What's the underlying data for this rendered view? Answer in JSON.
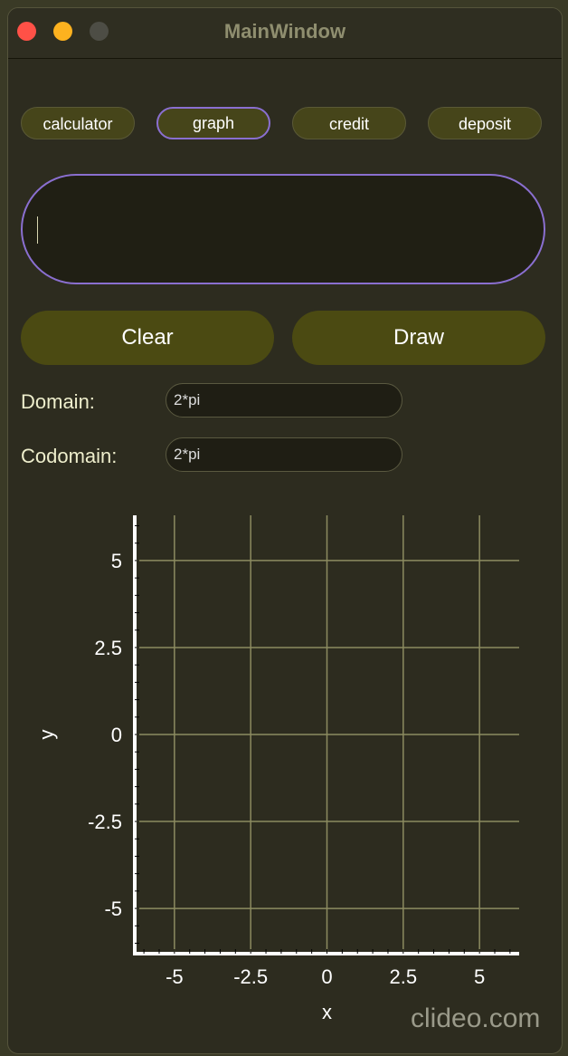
{
  "window": {
    "title": "MainWindow"
  },
  "tabs": [
    {
      "label": "calculator",
      "active": false
    },
    {
      "label": "graph",
      "active": true
    },
    {
      "label": "credit",
      "active": false
    },
    {
      "label": "deposit",
      "active": false
    }
  ],
  "expression": {
    "value": ""
  },
  "buttons": {
    "clear": "Clear",
    "draw": "Draw"
  },
  "domain": {
    "label": "Domain:",
    "value": "2*pi"
  },
  "codomain": {
    "label": "Codomain:",
    "value": "2*pi"
  },
  "chart_data": {
    "type": "line",
    "series": [],
    "xlabel": "x",
    "ylabel": "y",
    "xlim": [
      -6.3,
      6.3
    ],
    "ylim": [
      -6.3,
      6.3
    ],
    "xticks": [
      -5,
      -2.5,
      0,
      2.5,
      5
    ],
    "yticks": [
      -5,
      -2.5,
      0,
      2.5,
      5
    ],
    "xtick_labels": [
      "-5",
      "-2.5",
      "0",
      "2.5",
      "5"
    ],
    "ytick_labels": [
      "-5",
      "-2.5",
      "0",
      "2.5",
      "5"
    ],
    "grid": true
  },
  "watermark": "clideo.com",
  "colors": {
    "accent": "#8a6fd0",
    "button": "#4b4a12",
    "grid": "#8c8b60"
  }
}
